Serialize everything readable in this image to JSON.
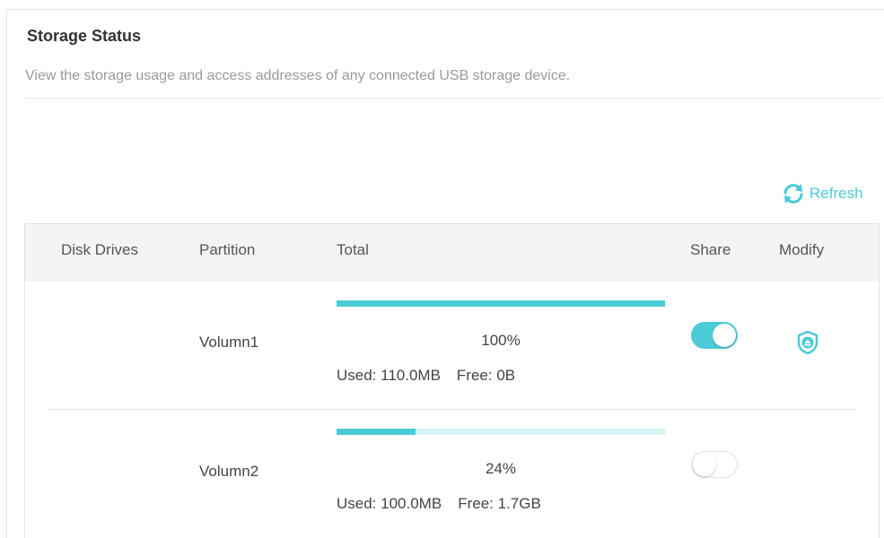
{
  "section": {
    "title": "Storage Status",
    "description": "View the storage usage and access addresses of any connected USB storage device."
  },
  "refresh": {
    "label": "Refresh",
    "icon": "refresh-icon"
  },
  "table": {
    "headers": {
      "disk_drives": "Disk Drives",
      "partition": "Partition",
      "total": "Total",
      "share": "Share",
      "modify": "Modify"
    },
    "rows": [
      {
        "disk_drive": "",
        "partition": "Volumn1",
        "usage_percent_label": "100%",
        "usage_fraction": 1.0,
        "used": "Used: 110.0MB",
        "free": "Free: 0B",
        "share_enabled": true,
        "modify_icon": "eject-shield-icon"
      },
      {
        "disk_drive": "",
        "partition": "Volumn2",
        "usage_percent_label": "24%",
        "usage_fraction": 0.24,
        "used": "Used: 100.0MB",
        "free": "Free: 1.7GB",
        "share_enabled": false
      }
    ]
  },
  "colors": {
    "accent": "#4acbd6",
    "bar_track": "#d5f3f5",
    "header_bg": "#f4f4f4"
  }
}
